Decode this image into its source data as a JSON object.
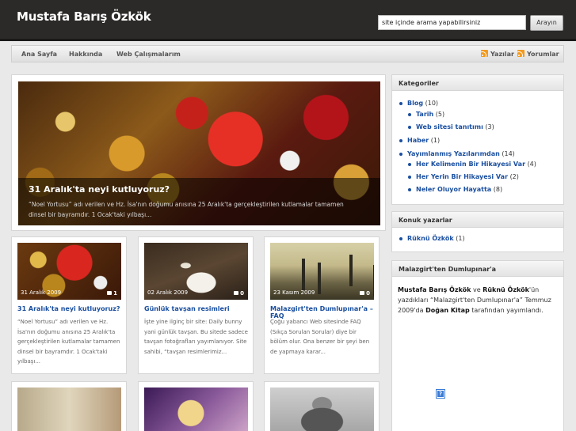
{
  "header": {
    "site_title": "Mustafa Barış Özkök",
    "search_placeholder": "site içinde arama yapabilirsiniz",
    "search_button": "Arayın"
  },
  "nav": {
    "items": [
      "Ana Sayfa",
      "Hakkında",
      "Web Çalışmalarım"
    ],
    "feeds": [
      "Yazılar",
      "Yorumlar"
    ]
  },
  "feature": {
    "title": "31 Aralık'ta neyi kutluyoruz?",
    "excerpt": "“Noel Yortusu” adı verilen ve Hz. İsa'nın doğumu anısına 25 Aralık'ta gerçekleştirilen kutlamalar tamamen dinsel bir bayramdır. 1 Ocak'taki yılbaşı..."
  },
  "cards": [
    {
      "date": "31 Aralık 2009",
      "comments": "1",
      "title": "31 Aralık'ta neyi kutluyoruz?",
      "excerpt": "“Noel Yortusu” adı verilen ve Hz. İsa'nın doğumu anısına 25 Aralık'ta gerçekleştirilen kutlamalar tamamen dinsel bir bayramdır. 1 Ocak'taki yılbaşı..."
    },
    {
      "date": "02 Aralık 2009",
      "comments": "0",
      "title": "Günlük tavşan resimleri",
      "excerpt": "İşte yine ilginç bir site: Daily bunny yani günlük tavşan. Bu sitede sadece tavşan fotoğrafları yayımlanıyor. Site sahibi, “tavşan resimlerimiz..."
    },
    {
      "date": "23 Kasım 2009",
      "comments": "0",
      "title": "Malazgirt'ten Dumlupınar'a – FAQ",
      "excerpt": "Çoğu yabancı Web sitesinde FAQ (Sıkça Sorulan Sorular) diye bir bölüm olur. Ona benzer bir şeyi ben de yapmaya karar..."
    }
  ],
  "sidebar": {
    "categories_title": "Kategoriler",
    "categories": [
      {
        "name": "Blog",
        "count": "(10)"
      },
      {
        "name": "Tarih",
        "count": "(5)"
      },
      {
        "name": "Web sitesi tanıtımı",
        "count": "(3)"
      },
      {
        "name": "Haber",
        "count": "(1)"
      },
      {
        "name": "Yayımlanmış Yazılarımdan",
        "count": "(14)"
      },
      {
        "name": "Her Kelimenin Bir Hikayesi Var",
        "count": "(4)"
      },
      {
        "name": "Her Yerin Bir Hikayesi Var",
        "count": "(2)"
      },
      {
        "name": "Neler Oluyor Hayatta",
        "count": "(8)"
      }
    ],
    "guest_title": "Konuk yazarlar",
    "guest": {
      "name": "Rüknü Özkök",
      "count": "(1)"
    },
    "book_title": "Malazgirt'ten Dumlupınar'a",
    "book": {
      "author1": "Mustafa Barış Özkök",
      "and": " ve ",
      "author2": "Rüknü Özkök",
      "text1": "'ün yazdıkları “Malazgirt'ten Dumlupınar'a” Temmuz 2009'da ",
      "publisher": "Doğan Kitap",
      "text2": " tarafından yayımlandı."
    },
    "help_glyph": "?"
  }
}
